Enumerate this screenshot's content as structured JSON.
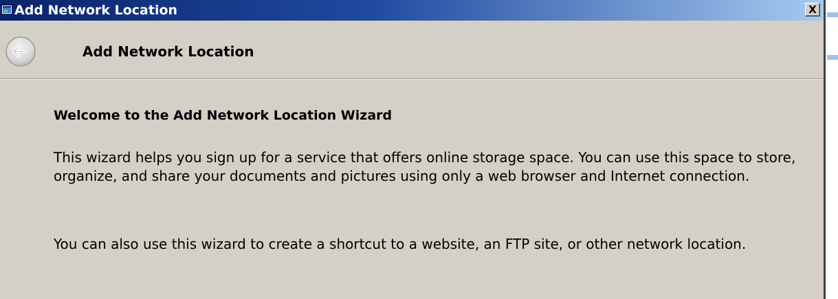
{
  "window": {
    "title": "Add Network Location",
    "close_label": "X"
  },
  "header": {
    "title": "Add Network Location"
  },
  "content": {
    "heading": "Welcome to the Add Network Location Wizard",
    "paragraph1": "This wizard helps you sign up for a service that offers online storage space.  You can use this space to store, organize, and share your documents and pictures using only a web browser and Internet connection.",
    "paragraph2": "You can also use this wizard to create a shortcut to a website, an FTP site, or other network location."
  },
  "icons": {
    "title_icon": "network-window-icon",
    "back_icon": "back-arrow-icon",
    "close_icon": "close-icon"
  }
}
